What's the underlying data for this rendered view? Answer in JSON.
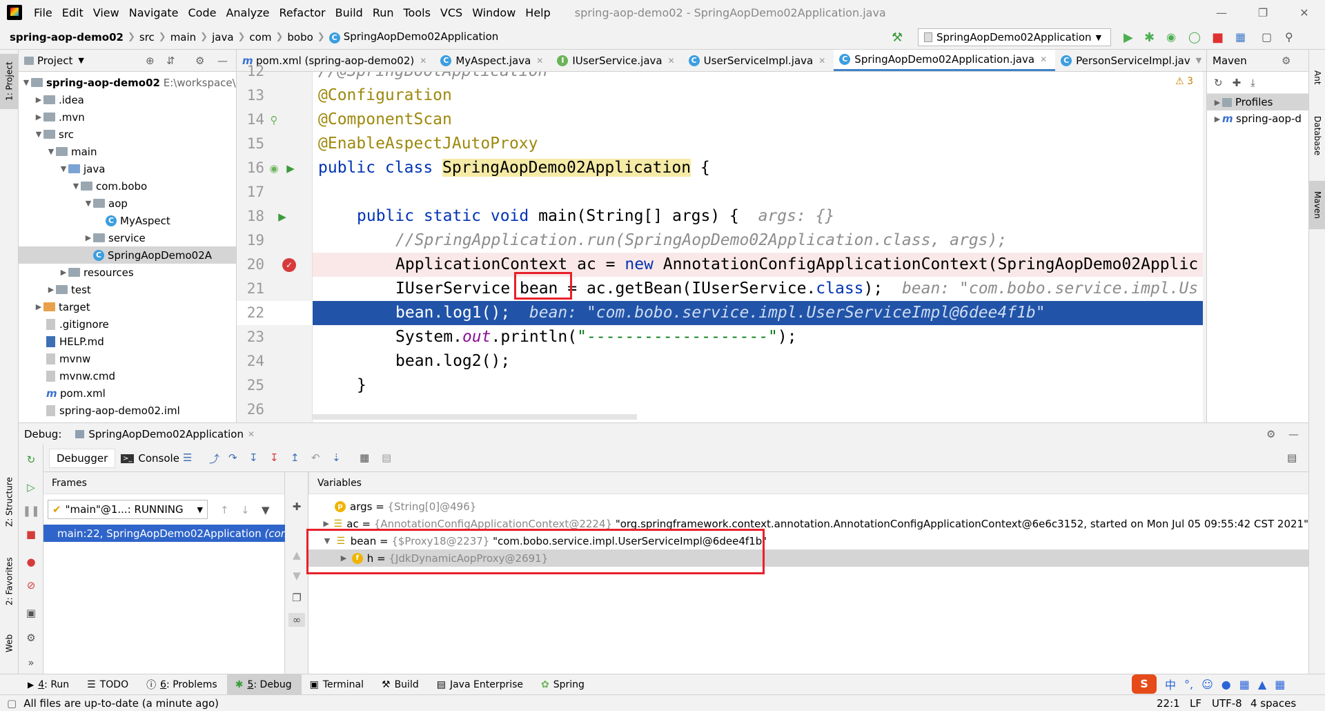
{
  "menu": {
    "items": [
      "File",
      "Edit",
      "View",
      "Navigate",
      "Code",
      "Analyze",
      "Refactor",
      "Build",
      "Run",
      "Tools",
      "VCS",
      "Window",
      "Help"
    ],
    "window_title": "spring-aop-demo02 - SpringAopDemo02Application.java"
  },
  "nav": {
    "project": "spring-aop-demo02",
    "crumbs": [
      "src",
      "main",
      "java",
      "com",
      "bobo"
    ],
    "current_class": "SpringAopDemo02Application",
    "run_config": "SpringAopDemo02Application"
  },
  "project_panel": {
    "title": "Project",
    "side_tab": "1: Project",
    "tree": [
      {
        "label": "spring-aop-demo02",
        "suffix": "E:\\workspace\\",
        "bold": true
      },
      {
        "label": ".idea"
      },
      {
        "label": ".mvn"
      },
      {
        "label": "src"
      },
      {
        "label": "main"
      },
      {
        "label": "java"
      },
      {
        "label": "com.bobo"
      },
      {
        "label": "aop"
      },
      {
        "label": "MyAspect"
      },
      {
        "label": "service"
      },
      {
        "label": "SpringAopDemo02A"
      },
      {
        "label": "resources"
      },
      {
        "label": "test"
      },
      {
        "label": "target"
      },
      {
        "label": ".gitignore"
      },
      {
        "label": "HELP.md"
      },
      {
        "label": "mvnw"
      },
      {
        "label": "mvnw.cmd"
      },
      {
        "label": "pom.xml"
      },
      {
        "label": "spring-aop-demo02.iml"
      }
    ]
  },
  "editor_tabs": [
    {
      "label": "pom.xml (spring-aop-demo02)"
    },
    {
      "label": "MyAspect.java"
    },
    {
      "label": "IUserService.java"
    },
    {
      "label": "UserServiceImpl.java"
    },
    {
      "label": "SpringAopDemo02Application.java",
      "active": true
    },
    {
      "label": "PersonServiceImpl.jav"
    }
  ],
  "editor": {
    "warning_count": "3",
    "line_numbers": [
      "12",
      "13",
      "14",
      "15",
      "16",
      "17",
      "18",
      "19",
      "20",
      "21",
      "22",
      "23",
      "24",
      "25",
      "26"
    ],
    "lines": {
      "l12": "//@SpringBootApplication",
      "l13": "@Configuration",
      "l14": "@ComponentScan",
      "l15": "@EnableAspectJAutoProxy",
      "l16_kw": "public class ",
      "l16_name": "SpringAopDemo02Application",
      "l16_end": " {",
      "l18_kw": "public static void ",
      "l18_rest": "main(String[] args) {",
      "l18_hint": "args: {}",
      "l19": "//SpringApplication.run(SpringAopDemo02Application.class, args);",
      "l20_a": "ApplicationContext ac = ",
      "l20_kw": "new ",
      "l20_b": "AnnotationConfigApplicationContext(SpringAopDemo02Applic",
      "l21_a": "IUserService ",
      "l21_var": "bean",
      "l21_b": " = ac.getBean(IUserService.",
      "l21_kw": "class",
      "l21_c": ");",
      "l21_hint": "bean: \"com.bobo.service.impl.Us",
      "l22": "bean.log1();",
      "l22_hint": "bean: \"com.bobo.service.impl.UserServiceImpl@6dee4f1b\"",
      "l23_a": "System.",
      "l23_fld": "out",
      "l23_b": ".println(",
      "l23_str": "\"-------------------\"",
      "l23_c": ");",
      "l24": "bean.log2();",
      "l25": "}"
    }
  },
  "maven_panel": {
    "title": "Maven",
    "items": [
      "Profiles",
      "spring-aop-d"
    ],
    "side_tabs": [
      "Ant",
      "Database",
      "Maven"
    ]
  },
  "debug": {
    "label": "Debug:",
    "session": "SpringAopDemo02Application",
    "tabs": [
      "Debugger",
      "Console"
    ],
    "frames_title": "Frames",
    "thread": "\"main\"@1...: RUNNING",
    "frame": "main:22, SpringAopDemo02Application",
    "frame_suffix": "(com",
    "variables_title": "Variables",
    "variables": [
      {
        "icon": "P",
        "name": "args",
        "type": "{String[0]@496}",
        "value": ""
      },
      {
        "icon": "eq",
        "name": "ac",
        "type": "{AnnotationConfigApplicationContext@2224}",
        "value": "\"org.springframework.context.annotation.AnnotationConfigApplicationContext@6e6c3152, started on Mon Jul 05 09:55:42 CST 2021\""
      },
      {
        "icon": "eq",
        "name": "bean",
        "type": "{$Proxy18@2237}",
        "value": "\"com.bobo.service.impl.UserServiceImpl@6dee4f1b\""
      },
      {
        "icon": "f",
        "name": "h",
        "type": "{JdkDynamicAopProxy@2691}",
        "value": ""
      }
    ],
    "side_tabs": [
      "Z: Structure",
      "2: Favorites",
      "Web"
    ]
  },
  "bottom_tabs": [
    {
      "num": "4",
      "label": ": Run"
    },
    {
      "num": "",
      "label": "TODO"
    },
    {
      "num": "6",
      "label": ": Problems"
    },
    {
      "num": "5",
      "label": ": Debug",
      "active": true
    },
    {
      "num": "",
      "label": "Terminal"
    },
    {
      "num": "",
      "label": "Build"
    },
    {
      "num": "",
      "label": "Java Enterprise"
    },
    {
      "num": "",
      "label": "Spring"
    }
  ],
  "status": {
    "message": "All files are up-to-date (a minute ago)",
    "position": "22:1",
    "line_sep": "LF",
    "encoding": "UTF-8",
    "indent": "4 spaces",
    "ime_text": "中"
  },
  "colors": {
    "accent": "#2154a8",
    "annotation_red": "#e8202a",
    "keyword": "#0033b3",
    "annotation": "#9e880d"
  }
}
